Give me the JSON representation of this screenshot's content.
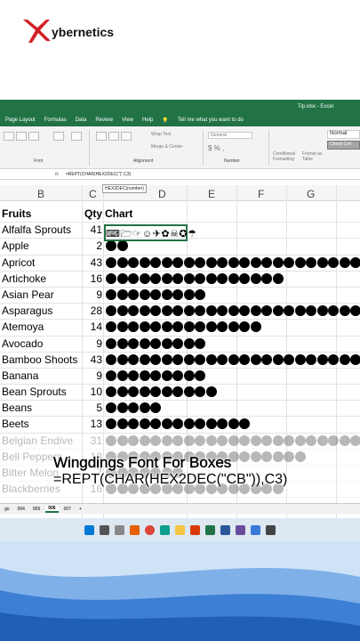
{
  "brand": {
    "name": "ybernetics"
  },
  "window": {
    "title": "Tip.xlsx - Excel"
  },
  "menu": [
    "Page Layout",
    "Formulas",
    "Data",
    "Review",
    "View",
    "Help",
    "Tell me what you want to do"
  ],
  "ribbon": {
    "font_group": "Font",
    "alignment_group": "Alignment",
    "number_group": "Number",
    "wrap_text": "Wrap Text",
    "merge_center": "Merge & Center",
    "number_format": "General",
    "conditional_formatting": "Conditional Formatting",
    "format_as_table": "Format as Table",
    "style_normal": "Normal",
    "style_check": "Check Cell"
  },
  "formula_bar": {
    "fx": "fx",
    "formula": "=REPT(CHAR(HEX2DEC(\"|\",C3)",
    "tooltip": "HEX2DEC(number)"
  },
  "columns": [
    "B",
    "C",
    "D",
    "E",
    "F",
    "G"
  ],
  "table": {
    "headers": {
      "fruit": "Fruits",
      "qty": "Qty",
      "chart": "Chart"
    },
    "rows": [
      {
        "fruit": "Alfalfa Sprouts",
        "qty": "41",
        "dots": 0
      },
      {
        "fruit": "Apple",
        "qty": "2",
        "dots": 2
      },
      {
        "fruit": "Apricot",
        "qty": "43",
        "dots": 24
      },
      {
        "fruit": "Artichoke",
        "qty": "16",
        "dots": 16
      },
      {
        "fruit": "Asian Pear",
        "qty": "9",
        "dots": 9
      },
      {
        "fruit": "Asparagus",
        "qty": "28",
        "dots": 24
      },
      {
        "fruit": "Atemoya",
        "qty": "14",
        "dots": 14
      },
      {
        "fruit": "Avocado",
        "qty": "9",
        "dots": 9
      },
      {
        "fruit": "Bamboo Shoots",
        "qty": "43",
        "dots": 24
      },
      {
        "fruit": "Banana",
        "qty": "9",
        "dots": 9
      },
      {
        "fruit": "Bean Sprouts",
        "qty": "10",
        "dots": 10
      },
      {
        "fruit": "Beans",
        "qty": "5",
        "dots": 5
      },
      {
        "fruit": "Beets",
        "qty": "13",
        "dots": 13
      },
      {
        "fruit": "Belgian Endive",
        "qty": "31",
        "dots": 24,
        "faded": true
      },
      {
        "fruit": "Bell Peppers",
        "qty": "18",
        "dots": 18,
        "faded": true
      },
      {
        "fruit": "Bitter Melon",
        "qty": "7",
        "dots": 7,
        "faded": true
      },
      {
        "fruit": "Blackberries",
        "qty": "16",
        "dots": 16,
        "faded": true
      }
    ],
    "wingdings_text": "⌨🗁☞☺✈✿☠✪☂"
  },
  "sheet_tabs": [
    "go",
    "004",
    "005",
    "006",
    "007",
    "+"
  ],
  "caption": {
    "line1": "Wingdings Font For Boxes",
    "line2": "=REPT(CHAR(HEX2DEC(\"CB\")),C3)"
  },
  "colors": {
    "excel_green": "#217346",
    "wallpaper": "#2f6fc6"
  }
}
